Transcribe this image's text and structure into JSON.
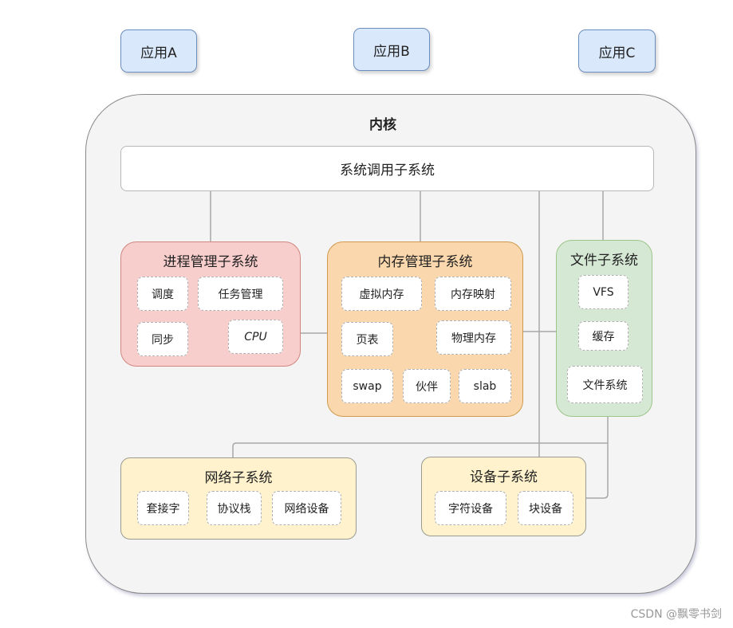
{
  "apps": [
    "应用A",
    "应用B",
    "应用C"
  ],
  "kernel": {
    "title": "内核",
    "syscall": "系统调用子系统",
    "process": {
      "title": "进程管理子系统",
      "items": [
        "调度",
        "任务管理",
        "同步",
        "CPU"
      ]
    },
    "memory": {
      "title": "内存管理子系统",
      "items": [
        "虚拟内存",
        "内存映射",
        "页表",
        "物理内存",
        "swap",
        "伙伴",
        "slab"
      ]
    },
    "file": {
      "title": "文件子系统",
      "items": [
        "VFS",
        "缓存",
        "文件系统"
      ]
    },
    "network": {
      "title": "网络子系统",
      "items": [
        "套接字",
        "协议栈",
        "网络设备"
      ]
    },
    "device": {
      "title": "设备子系统",
      "items": [
        "字符设备",
        "块设备"
      ]
    }
  },
  "colors": {
    "app_fill": "#dae8fc",
    "process_fill": "#f8cecc",
    "memory_fill": "#fad7ac",
    "file_fill": "#d5e8d4",
    "network_fill": "#fff2cc",
    "device_fill": "#fff2cc"
  },
  "watermark": "CSDN @飘零书剑"
}
